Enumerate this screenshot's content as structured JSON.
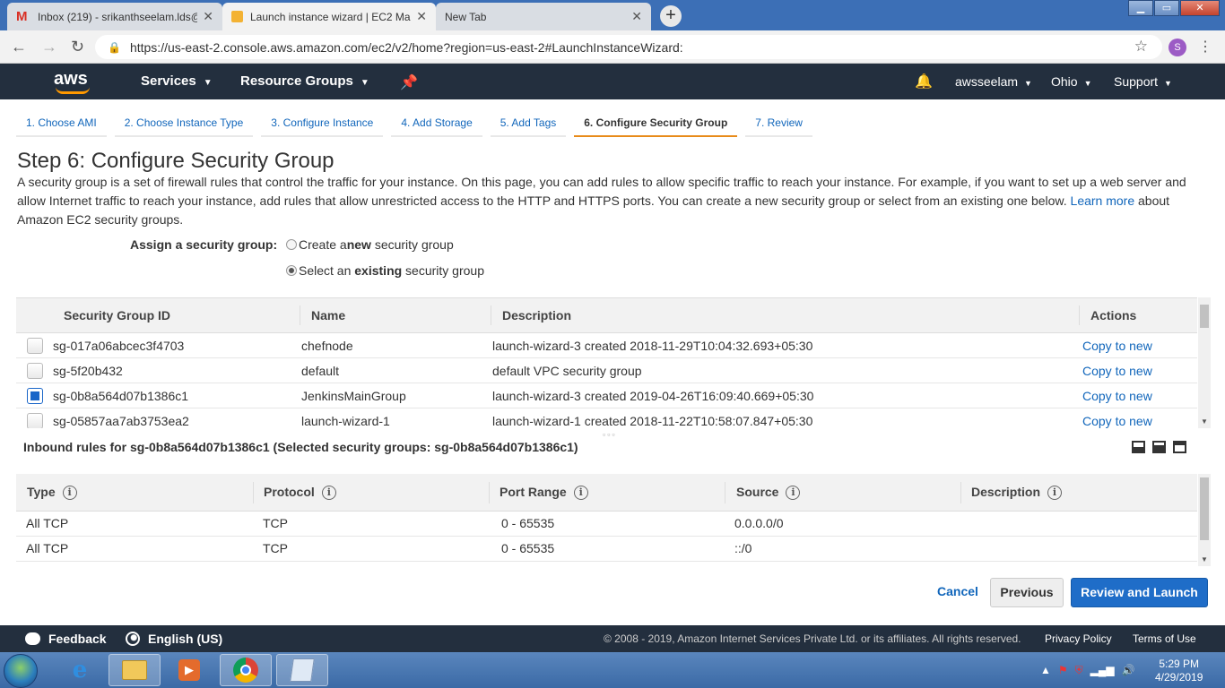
{
  "browser": {
    "tabs": [
      {
        "label": "Inbox (219) - srikanthseelam.lds@",
        "icon": "gmail-icon"
      },
      {
        "label": "Launch instance wizard | EC2 Ma",
        "icon": "aws-cube-icon"
      },
      {
        "label": "New Tab",
        "icon": ""
      }
    ],
    "url": "https://us-east-2.console.aws.amazon.com/ec2/v2/home?region=us-east-2#LaunchInstanceWizard:",
    "profile_initial": "S"
  },
  "aws_nav": {
    "logo": "aws",
    "services": "Services",
    "resource_groups": "Resource Groups",
    "user": "awsseelam",
    "region": "Ohio",
    "support": "Support"
  },
  "wizard": {
    "steps": [
      "1. Choose AMI",
      "2. Choose Instance Type",
      "3. Configure Instance",
      "4. Add Storage",
      "5. Add Tags",
      "6. Configure Security Group",
      "7. Review"
    ],
    "active_step": 5
  },
  "page": {
    "title": "Step 6: Configure Security Group",
    "intro": "A security group is a set of firewall rules that control the traffic for your instance. On this page, you can add rules to allow specific traffic to reach your instance. For example, if you want to set up a web server and allow Internet traffic to reach your instance, add rules that allow unrestricted access to the HTTP and HTTPS ports. You can create a new security group or select from an existing one below.",
    "learn_more": "Learn more",
    "intro_tail": "about Amazon EC2 security groups.",
    "assign_label": "Assign a security group:",
    "option_create": {
      "pre": "Create a ",
      "bold": "new",
      "post": " security group",
      "selected": false
    },
    "option_existing": {
      "pre": "Select an ",
      "bold": "existing",
      "post": " security group",
      "selected": true
    }
  },
  "sg_table": {
    "headers": [
      "Security Group ID",
      "Name",
      "Description",
      "Actions"
    ],
    "rows": [
      {
        "id": "sg-017a06abcec3f4703",
        "name": "chefnode",
        "description": "launch-wizard-3 created 2018-11-29T10:04:32.693+05:30",
        "action": "Copy to new",
        "checked": false
      },
      {
        "id": "sg-5f20b432",
        "name": "default",
        "description": "default VPC security group",
        "action": "Copy to new",
        "checked": false
      },
      {
        "id": "sg-0b8a564d07b1386c1",
        "name": "JenkinsMainGroup",
        "description": "launch-wizard-3 created 2019-04-26T16:09:40.669+05:30",
        "action": "Copy to new",
        "checked": true
      },
      {
        "id": "sg-05857aa7ab3753ea2",
        "name": "launch-wizard-1",
        "description": "launch-wizard-1 created 2018-11-22T10:58:07.847+05:30",
        "action": "Copy to new",
        "checked": false
      }
    ]
  },
  "inbound": {
    "title": "Inbound rules for sg-0b8a564d07b1386c1 (Selected security groups: sg-0b8a564d07b1386c1)",
    "headers": [
      "Type",
      "Protocol",
      "Port Range",
      "Source",
      "Description"
    ],
    "rows": [
      {
        "type": "All TCP",
        "protocol": "TCP",
        "port_range": "0 - 65535",
        "source": "0.0.0.0/0",
        "description": ""
      },
      {
        "type": "All TCP",
        "protocol": "TCP",
        "port_range": "0 - 65535",
        "source": "::/0",
        "description": ""
      }
    ]
  },
  "buttons": {
    "cancel": "Cancel",
    "previous": "Previous",
    "review_launch": "Review and Launch"
  },
  "footer": {
    "feedback": "Feedback",
    "language": "English (US)",
    "copyright": "© 2008 - 2019, Amazon Internet Services Private Ltd. or its affiliates. All rights reserved.",
    "privacy": "Privacy Policy",
    "terms": "Terms of Use"
  },
  "taskbar": {
    "time": "5:29 PM",
    "date": "4/29/2019"
  },
  "colors": {
    "aws_nav_bg": "#232f3e",
    "link_blue": "#1166bb",
    "primary_button": "#1f6dc8",
    "active_step_underline": "#e88b1a"
  }
}
